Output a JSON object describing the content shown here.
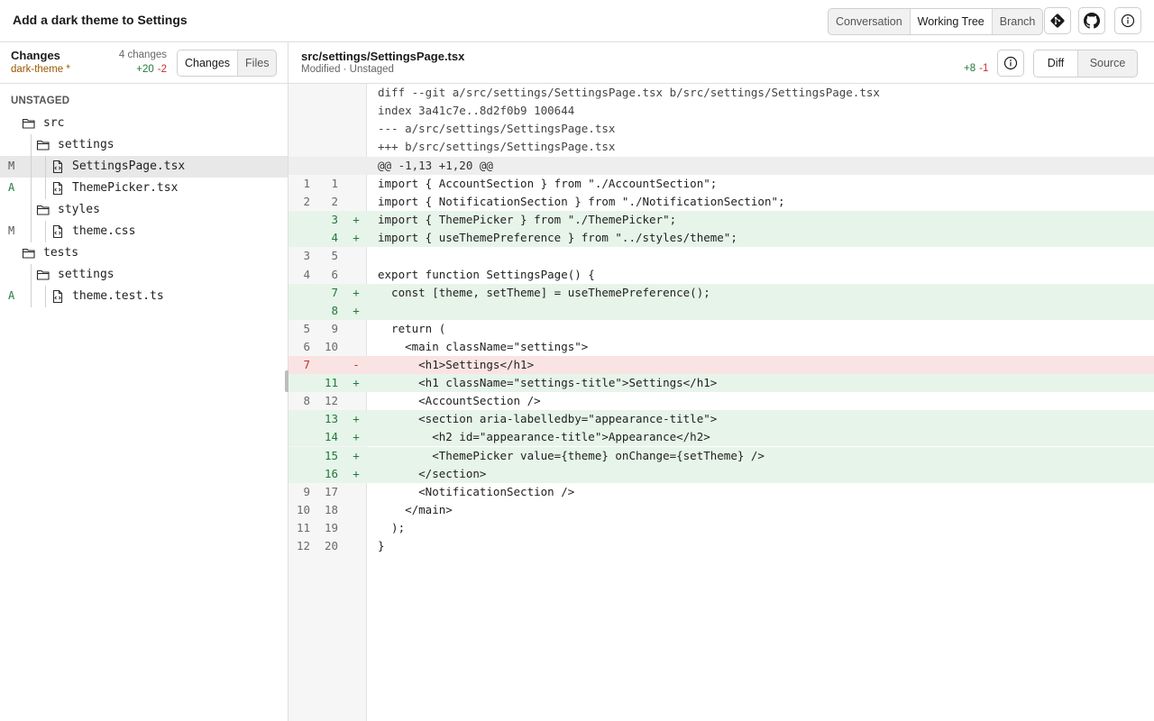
{
  "topbar": {
    "title": "Add a dark theme to Settings",
    "views": [
      "Conversation",
      "Working Tree",
      "Branch"
    ],
    "active_view": "Working Tree",
    "icons": [
      "git-icon",
      "github-icon",
      "info-icon"
    ]
  },
  "sidebar": {
    "title": "Changes",
    "branch": "dark-theme *",
    "change_count": "4 changes",
    "additions": "+20",
    "deletions": "-2",
    "tabs": [
      "Changes",
      "Files"
    ],
    "active_tab": "Changes",
    "section": "UNSTAGED",
    "tree": [
      {
        "label": "src",
        "type": "folder",
        "status": ""
      },
      {
        "label": "settings",
        "type": "folder",
        "status": ""
      },
      {
        "label": "SettingsPage.tsx",
        "type": "file",
        "status": "M",
        "selected": true
      },
      {
        "label": "ThemePicker.tsx",
        "type": "file",
        "status": "A"
      },
      {
        "label": "styles",
        "type": "folder",
        "status": ""
      },
      {
        "label": "theme.css",
        "type": "file",
        "status": "M"
      },
      {
        "label": "tests",
        "type": "folder",
        "status": ""
      },
      {
        "label": "settings",
        "type": "folder",
        "status": ""
      },
      {
        "label": "theme.test.ts",
        "type": "file",
        "status": "A"
      }
    ]
  },
  "file": {
    "path": "src/settings/SettingsPage.tsx",
    "status": "Modified · Unstaged",
    "additions": "+8",
    "deletions": "-1",
    "view_modes": [
      "Diff",
      "Source"
    ],
    "active_mode": "Diff"
  },
  "diff": {
    "header_lines": [
      "diff --git a/src/settings/SettingsPage.tsx b/src/settings/SettingsPage.tsx",
      "index 3a41c7e..8d2f0b9 100644",
      "--- a/src/settings/SettingsPage.tsx",
      "+++ b/src/settings/SettingsPage.tsx"
    ],
    "hunk": "@@ -1,13 +1,20 @@",
    "lines": [
      {
        "o": "1",
        "n": "1",
        "t": "ctx",
        "code": "import { AccountSection } from \"./AccountSection\";"
      },
      {
        "o": "2",
        "n": "2",
        "t": "ctx",
        "code": "import { NotificationSection } from \"./NotificationSection\";"
      },
      {
        "o": "",
        "n": "3",
        "t": "add",
        "code": "import { ThemePicker } from \"./ThemePicker\";"
      },
      {
        "o": "",
        "n": "4",
        "t": "add",
        "code": "import { useThemePreference } from \"../styles/theme\";"
      },
      {
        "o": "3",
        "n": "5",
        "t": "ctx",
        "code": ""
      },
      {
        "o": "4",
        "n": "6",
        "t": "ctx",
        "code": "export function SettingsPage() {"
      },
      {
        "o": "",
        "n": "7",
        "t": "add",
        "code": "  const [theme, setTheme] = useThemePreference();"
      },
      {
        "o": "",
        "n": "8",
        "t": "add",
        "code": ""
      },
      {
        "o": "5",
        "n": "9",
        "t": "ctx",
        "code": "  return ("
      },
      {
        "o": "6",
        "n": "10",
        "t": "ctx",
        "code": "    <main className=\"settings\">"
      },
      {
        "o": "7",
        "n": "",
        "t": "del",
        "code": "      <h1>Settings</h1>"
      },
      {
        "o": "",
        "n": "11",
        "t": "add",
        "code": "      <h1 className=\"settings-title\">Settings</h1>"
      },
      {
        "o": "8",
        "n": "12",
        "t": "ctx",
        "code": "      <AccountSection />"
      },
      {
        "o": "",
        "n": "13",
        "t": "add",
        "code": "      <section aria-labelledby=\"appearance-title\">"
      },
      {
        "o": "",
        "n": "14",
        "t": "add",
        "code": "        <h2 id=\"appearance-title\">Appearance</h2>"
      },
      {
        "o": "",
        "n": "15",
        "t": "add",
        "code": "        <ThemePicker value={theme} onChange={setTheme} />"
      },
      {
        "o": "",
        "n": "16",
        "t": "add",
        "code": "      </section>"
      },
      {
        "o": "9",
        "n": "17",
        "t": "ctx",
        "code": "      <NotificationSection />"
      },
      {
        "o": "10",
        "n": "18",
        "t": "ctx",
        "code": "    </main>"
      },
      {
        "o": "11",
        "n": "19",
        "t": "ctx",
        "code": "  );"
      },
      {
        "o": "12",
        "n": "20",
        "t": "ctx",
        "code": "}"
      }
    ]
  }
}
